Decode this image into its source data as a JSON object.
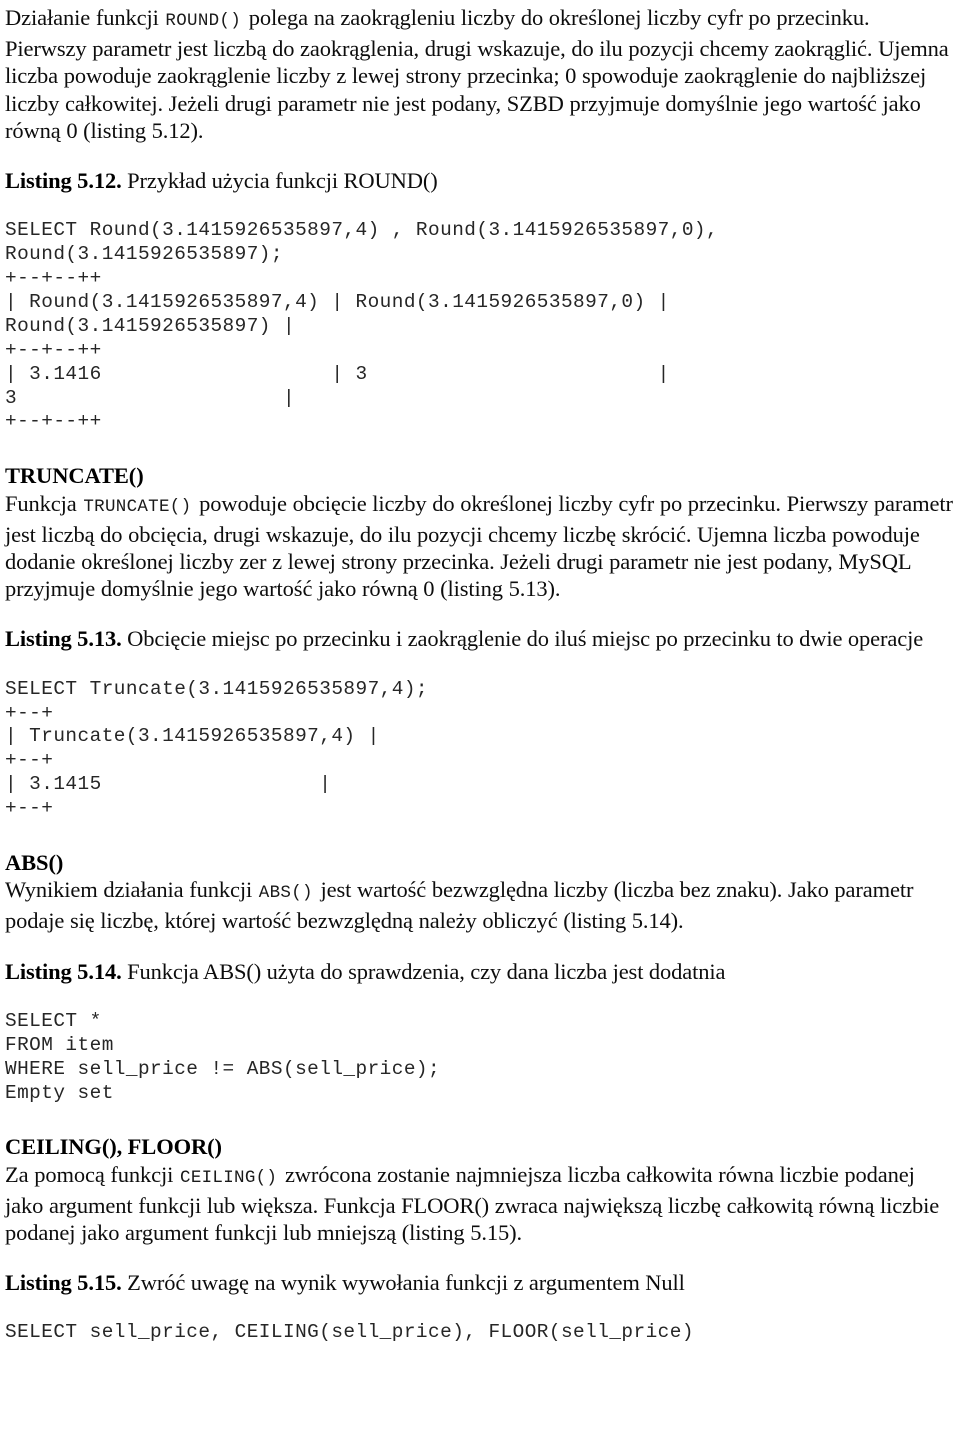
{
  "document": {
    "language": "pl",
    "body_font_color": "#0d0d0d",
    "code_font_color": "#262626",
    "background": "#ffffff"
  },
  "blocks": {
    "round_intro": {
      "lead": "Działanie funkcji ",
      "code": "ROUND()",
      "rest": " polega na zaokrągleniu liczby do określonej liczby cyfr po przecinku. Pierwszy parametr jest liczbą do zaokrąglenia, drugi wskazuje, do ilu pozycji chcemy zaokrąglić. Ujemna liczba powoduje zaokrąglenie liczby z lewej strony przecinka; 0 spowoduje zaokrąglenie do najbliższej liczby całkowitej. Jeżeli drugi parametr nie jest podany, SZBD przyjmuje domyślnie jego wartość jako równą 0 (listing 5.12)."
    },
    "listing_512": {
      "label": "Listing 5.12.",
      "caption": " Przykład użycia funkcji ROUND()",
      "code": "SELECT Round(3.1415926535897,4) , Round(3.1415926535897,0),\nRound(3.1415926535897);\n+--+--++\n| Round(3.1415926535897,4) | Round(3.1415926535897,0) |\nRound(3.1415926535897) |\n+--+--++\n| 3.1416                   | 3                        |\n3                      |\n+--+--++"
    },
    "truncate": {
      "heading": "TRUNCATE()",
      "lead": "Funkcja ",
      "code": "TRUNCATE()",
      "rest": " powoduje obcięcie liczby do określonej liczby cyfr po przecinku. Pierwszy parametr jest liczbą do obcięcia, drugi wskazuje, do ilu pozycji chcemy liczbę skrócić. Ujemna liczba powoduje dodanie określonej liczby zer z lewej strony przecinka. Jeżeli drugi parametr nie jest podany, MySQL przyjmuje domyślnie jego wartość jako równą 0 (listing 5.13)."
    },
    "listing_513": {
      "label": "Listing 5.13.",
      "caption": " Obcięcie miejsc po przecinku i zaokrąglenie do iluś miejsc po przecinku to dwie operacje",
      "code": "SELECT Truncate(3.1415926535897,4);\n+--+\n| Truncate(3.1415926535897,4) |\n+--+\n| 3.1415                  |\n+--+"
    },
    "abs": {
      "heading": "ABS()",
      "lead": "Wynikiem działania funkcji ",
      "code": "ABS()",
      "rest": " jest wartość bezwzględna liczby (liczba bez znaku). Jako parametr podaje się liczbę, której wartość bezwzględną należy obliczyć (listing 5.14)."
    },
    "listing_514": {
      "label": "Listing 5.14.",
      "caption": " Funkcja ABS() użyta do sprawdzenia, czy dana liczba jest dodatnia",
      "code": "SELECT *\nFROM item\nWHERE sell_price != ABS(sell_price);\nEmpty set"
    },
    "ceiling_floor": {
      "heading": "CEILING(), FLOOR()",
      "lead": "Za pomocą funkcji ",
      "code": "CEILING()",
      "rest": " zwrócona zostanie najmniejsza liczba całkowita równa liczbie podanej jako argument funkcji lub większa. Funkcja FLOOR() zwraca największą liczbę całkowitą równą liczbie podanej jako argument funkcji lub mniejszą (listing 5.15)."
    },
    "listing_515": {
      "label": "Listing 5.15.",
      "caption": " Zwróć uwagę na wynik wywołania funkcji z argumentem Null",
      "code": "SELECT sell_price, CEILING(sell_price), FLOOR(sell_price)"
    }
  }
}
